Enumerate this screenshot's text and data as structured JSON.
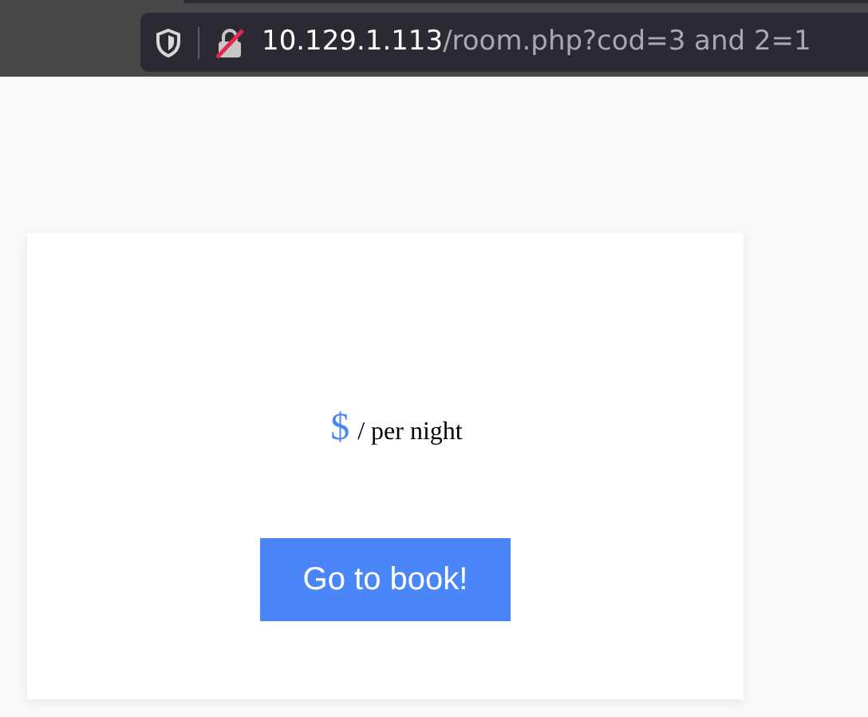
{
  "address_bar": {
    "host": "10.129.1.113",
    "path": "/room.php?cod=3 and 2=1"
  },
  "room": {
    "price": "$",
    "unit": "/ per night",
    "button": "Go to book!"
  }
}
